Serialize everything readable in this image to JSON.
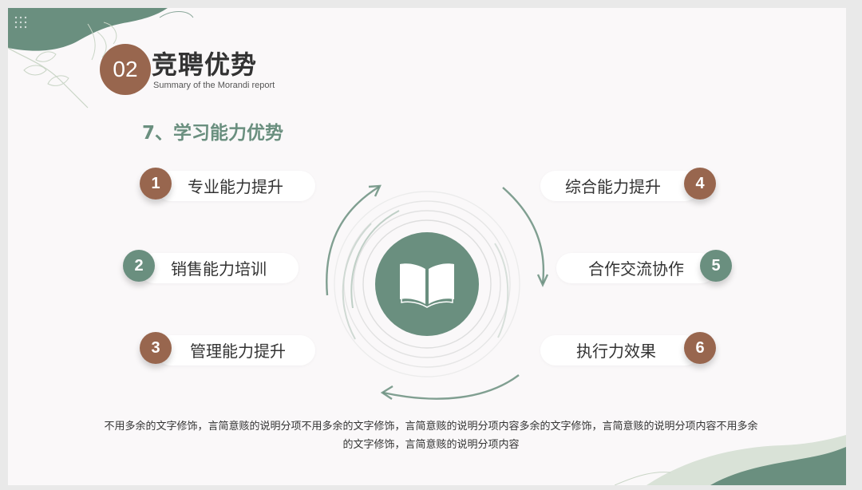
{
  "header": {
    "number": "02",
    "title": "竞聘优势",
    "subtitle": "Summary of the Morandi report"
  },
  "section": {
    "heading": "7、学习能力优势"
  },
  "items": [
    {
      "num": "1",
      "label": "专业能力提升",
      "color": "#98664e"
    },
    {
      "num": "2",
      "label": "销售能力培训",
      "color": "#6a8f7f"
    },
    {
      "num": "3",
      "label": "管理能力提升",
      "color": "#98664e"
    },
    {
      "num": "4",
      "label": "综合能力提升",
      "color": "#98664e"
    },
    {
      "num": "5",
      "label": "合作交流协作",
      "color": "#6a8f7f"
    },
    {
      "num": "6",
      "label": "执行力效果",
      "color": "#98664e"
    }
  ],
  "center": {
    "icon": "open-book-icon",
    "color": "#6a8f7f"
  },
  "footer": {
    "text": "不用多余的文字修饰，言简意赅的说明分项不用多余的文字修饰，言简意赅的说明分项内容多余的文字修饰，言简意赅的说明分项内容不用多余的文字修饰，言简意赅的说明分项内容"
  }
}
